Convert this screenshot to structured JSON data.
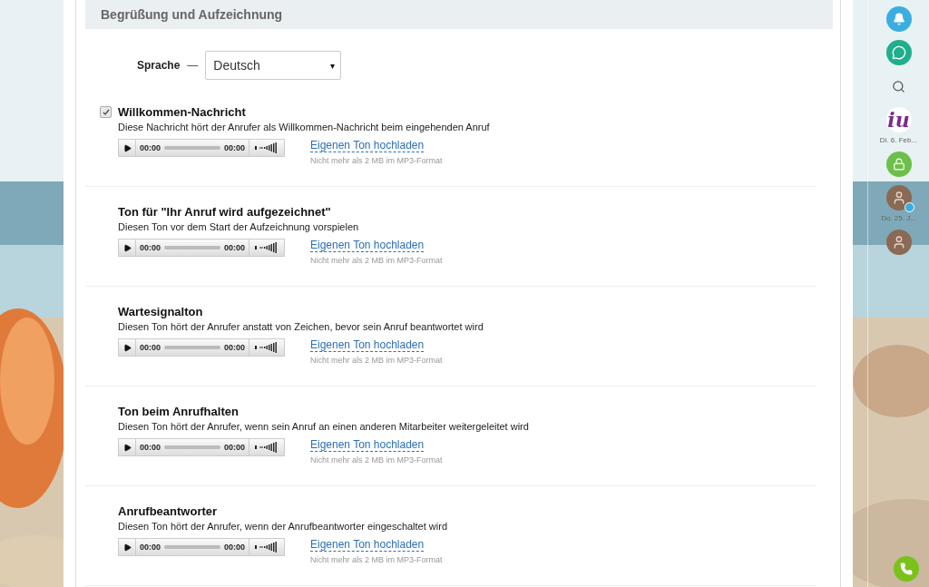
{
  "section": {
    "title": "Begrüßung und Aufzeichnung"
  },
  "language": {
    "label": "Sprache",
    "dash": "—",
    "value": "Deutsch",
    "caret": "▾"
  },
  "sounds": [
    {
      "title": "Willkommen-Nachricht",
      "checked": true,
      "description": "Diese Nachricht hört der Anrufer als Willkommen-Nachricht beim eingehenden Anruf",
      "time_start": "00:00",
      "time_end": "00:00",
      "upload": "Eigenen Ton hochladen",
      "hint": "Nicht mehr als 2 MB im MP3-Format"
    },
    {
      "title": "Ton für \"Ihr Anruf wird aufgezeichnet\"",
      "description": "Diesen Ton vor dem Start der Aufzeichnung vorspielen",
      "time_start": "00:00",
      "time_end": "00:00",
      "upload": "Eigenen Ton hochladen",
      "hint": "Nicht mehr als 2 MB im MP3-Format"
    },
    {
      "title": "Wartesignalton",
      "description": "Diesen Ton hört der Anrufer anstatt von Zeichen, bevor sein Anruf beantwortet wird",
      "time_start": "00:00",
      "time_end": "00:00",
      "upload": "Eigenen Ton hochladen",
      "hint": "Nicht mehr als 2 MB im MP3-Format"
    },
    {
      "title": "Ton beim Anrufhalten",
      "description": "Diesen Ton hört der Anrufer, wenn sein Anruf an einen anderen Mitarbeiter weitergeleitet wird",
      "time_start": "00:00",
      "time_end": "00:00",
      "upload": "Eigenen Ton hochladen",
      "hint": "Nicht mehr als 2 MB im MP3-Format"
    },
    {
      "title": "Anrufbeantworter",
      "description": "Diesen Ton hört der Anrufer, wenn der Anrufbeantworter eingeschaltet wird",
      "time_start": "00:00",
      "time_end": "00:00",
      "upload": "Eigenen Ton hochladen",
      "hint": "Nicht mehr als 2 MB im MP3-Format"
    }
  ],
  "sidebar": {
    "items": [
      {
        "kind": "bell",
        "color": "#3aaee0"
      },
      {
        "kind": "chat",
        "color": "#1fae8e"
      },
      {
        "kind": "search"
      },
      {
        "kind": "logo",
        "logo_text": "iu",
        "date": "Di. 6. Feb..."
      },
      {
        "kind": "lock",
        "color": "#6cc04a"
      },
      {
        "kind": "avatar",
        "date": "Do. 25. J...",
        "badge": true
      },
      {
        "kind": "avatar"
      }
    ],
    "call": {
      "color": "#7ac21a"
    }
  }
}
